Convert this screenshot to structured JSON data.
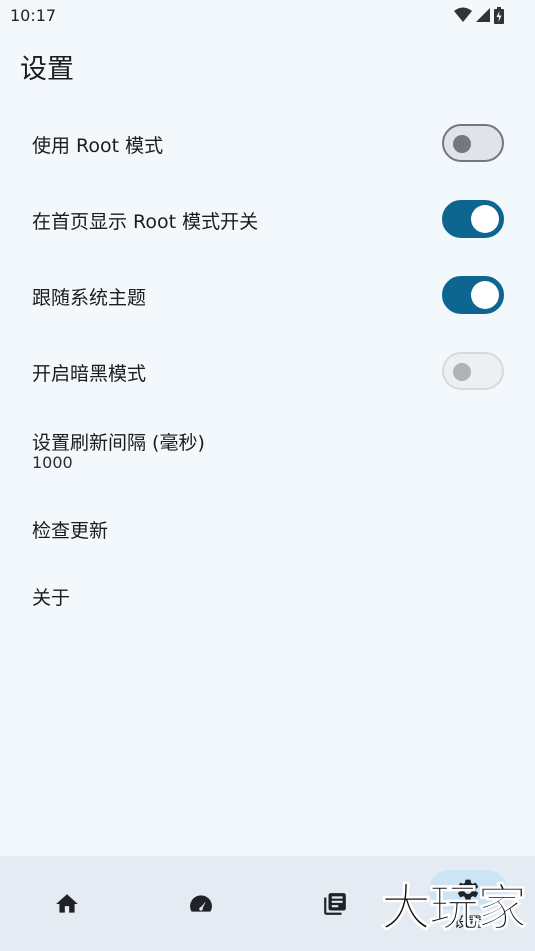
{
  "status_bar": {
    "time": "10:17",
    "icons": [
      "wifi-icon",
      "signal-icon",
      "battery-icon"
    ]
  },
  "page": {
    "title": "设置"
  },
  "settings": [
    {
      "label": "使用 Root 模式",
      "type": "switch",
      "checked": false,
      "enabled": true
    },
    {
      "label": "在首页显示 Root 模式开关",
      "type": "switch",
      "checked": true,
      "enabled": true
    },
    {
      "label": "跟随系统主题",
      "type": "switch",
      "checked": true,
      "enabled": true
    },
    {
      "label": "开启暗黑模式",
      "type": "switch",
      "checked": false,
      "enabled": false
    },
    {
      "label": "设置刷新间隔 (毫秒)",
      "type": "value",
      "value": "1000"
    },
    {
      "label": "检查更新",
      "type": "action"
    },
    {
      "label": "关于",
      "type": "action"
    }
  ],
  "bottom_nav": {
    "items": [
      {
        "icon": "home-icon",
        "label": "",
        "active": false
      },
      {
        "icon": "speedometer-icon",
        "label": "",
        "active": false
      },
      {
        "icon": "library-icon",
        "label": "",
        "active": false
      },
      {
        "icon": "gear-icon",
        "label": "设置",
        "active": true
      }
    ]
  },
  "watermark": {
    "text": "大玩家"
  },
  "colors": {
    "background": "#f3f8fd",
    "accent": "#0c6690",
    "nav_background": "#e4ebf2",
    "nav_active_pill": "#cde4f5"
  }
}
